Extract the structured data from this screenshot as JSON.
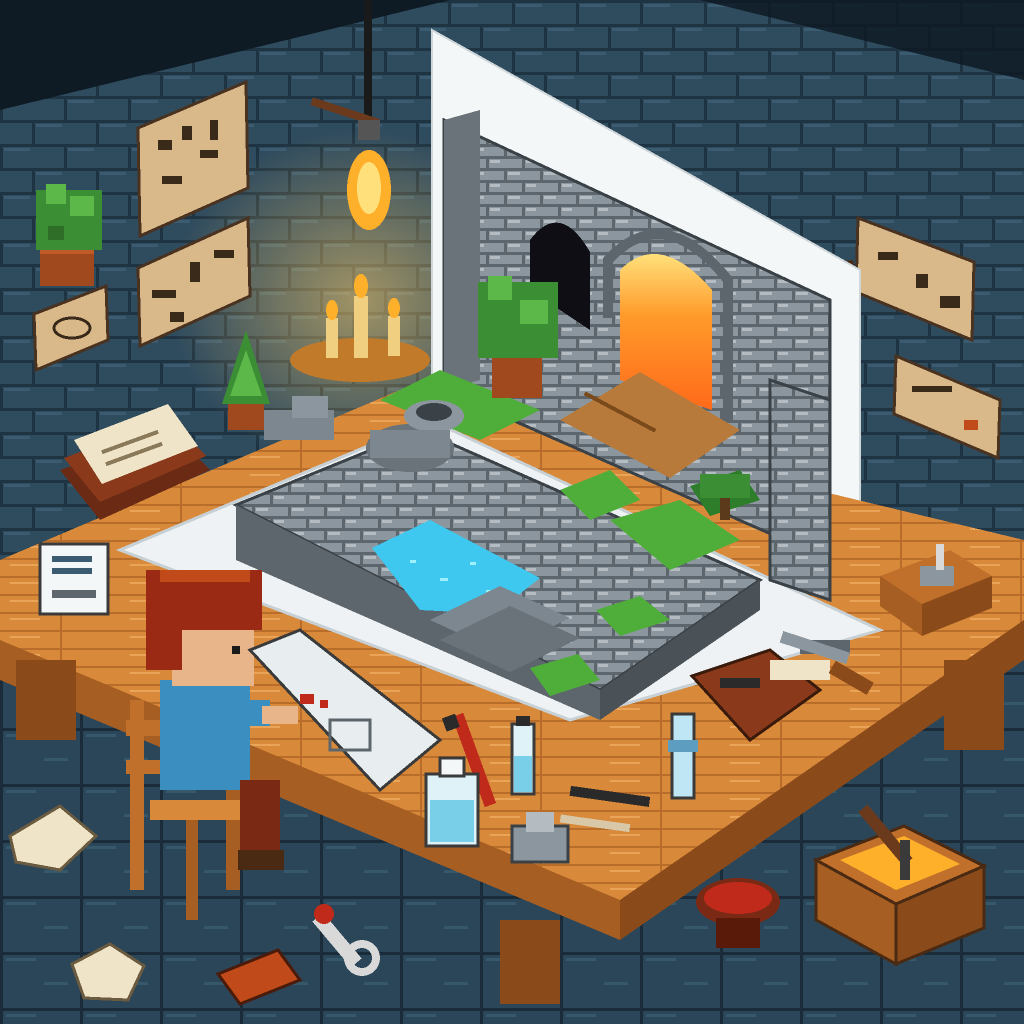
{
  "scene": {
    "palette": {
      "wall": "#2f4b5e",
      "wall_dark": "#1f3443",
      "wall_line": "#1a2c39",
      "floor": "#2a4658",
      "floor_light": "#36586b",
      "table_top": "#d88a3a",
      "table_edge": "#a65e22",
      "table_leg": "#8a4a1a",
      "paper": "#eef2f4",
      "stone": "#8c969e",
      "stone_dark": "#5d666d",
      "stone_light": "#b4bcc2",
      "water": "#3ec8f0",
      "water_light": "#9ff0ff",
      "grass": "#4fae3a",
      "grass_dark": "#2e7d2a",
      "fire": "#ff9a2a",
      "fire_core": "#ffe07a",
      "parchment": "#d9b98a",
      "character_hair": "#9a2a14",
      "character_shirt": "#3a8fc0",
      "chair": "#c0702a"
    },
    "icons": [
      "hanging-bulb-icon",
      "candle-icon",
      "potted-plant-icon",
      "wall-map-icon",
      "book-stack-icon",
      "blueprint-note-icon",
      "water-bottle-icon",
      "pencil-icon",
      "paint-vial-icon",
      "toolbox-icon",
      "wrench-icon",
      "crate-icon",
      "bowl-icon",
      "pebble-icon"
    ]
  }
}
